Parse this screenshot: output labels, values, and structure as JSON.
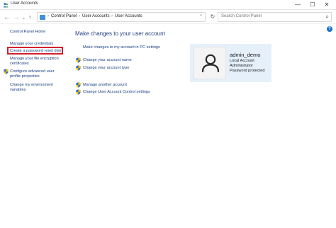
{
  "window": {
    "title": "User Accounts",
    "minimize_glyph": "—",
    "maximize_glyph": "☐",
    "close_glyph": "✕"
  },
  "address_bar": {
    "back_glyph": "←",
    "forward_glyph": "→",
    "dropdown_glyph": "⌄",
    "up_glyph": "↑",
    "breadcrumbs": [
      "Control Panel",
      "User Accounts",
      "User Accounts"
    ],
    "separator": "›",
    "refresh_glyph": "↻",
    "search_placeholder": "Search Control Panel",
    "search_glyph": "⌕"
  },
  "help": {
    "glyph": "?"
  },
  "sidebar": {
    "home_label": "Control Panel Home",
    "items": [
      "Manage your credentials",
      "Create a password reset disk",
      "Manage your file encryption",
      "certificates",
      "Configure advanced user",
      "profile properties",
      "Change my environment",
      "variables"
    ]
  },
  "main": {
    "heading": "Make changes to your user account",
    "links": [
      "Make changes to my account in PC settings",
      "Change your account name",
      "Change your account type",
      "Manage another account",
      "Change User Account Control settings"
    ]
  },
  "user_card": {
    "name": "admin_demo",
    "details": [
      "Local Account",
      "Administrator",
      "Password protected"
    ]
  }
}
